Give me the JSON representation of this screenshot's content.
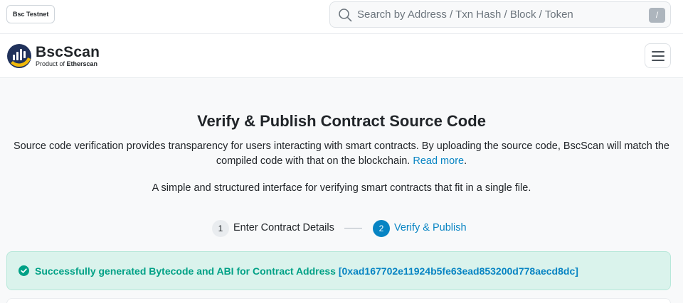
{
  "topbar": {
    "network_badge": "Bsc Testnet",
    "search": {
      "placeholder": "Search by Address / Txn Hash / Block / Token",
      "shortcut_key": "/"
    }
  },
  "navbar": {
    "brand_name": "BscScan",
    "brand_sub_prefix": "Product of ",
    "brand_sub_name": "Etherscan"
  },
  "main": {
    "title": "Verify & Publish Contract Source Code",
    "description": "Source code verification provides transparency for users interacting with smart contracts. By uploading the source code, BscScan will match the compiled code with that on the blockchain.",
    "read_more": "Read more",
    "description_end": ".",
    "subdescription": "A simple and structured interface for verifying smart contracts that fit in a single file.",
    "steps": [
      {
        "number": "1",
        "label": "Enter Contract Details",
        "active": false
      },
      {
        "number": "2",
        "label": "Verify & Publish",
        "active": true
      }
    ],
    "alert": {
      "message": "Successfully generated Bytecode and ABI for Contract Address ",
      "address": "[0xad167702e11924b5fe63ead853200d778aecd8dc]"
    }
  },
  "colors": {
    "accent": "#0784c3",
    "success": "#00a186",
    "success_bg": "#daf3ec",
    "brand_yellow": "#f0b90b"
  },
  "icons": [
    "search-icon",
    "bscscan-logo-icon",
    "menu-icon",
    "check-circle-icon"
  ]
}
